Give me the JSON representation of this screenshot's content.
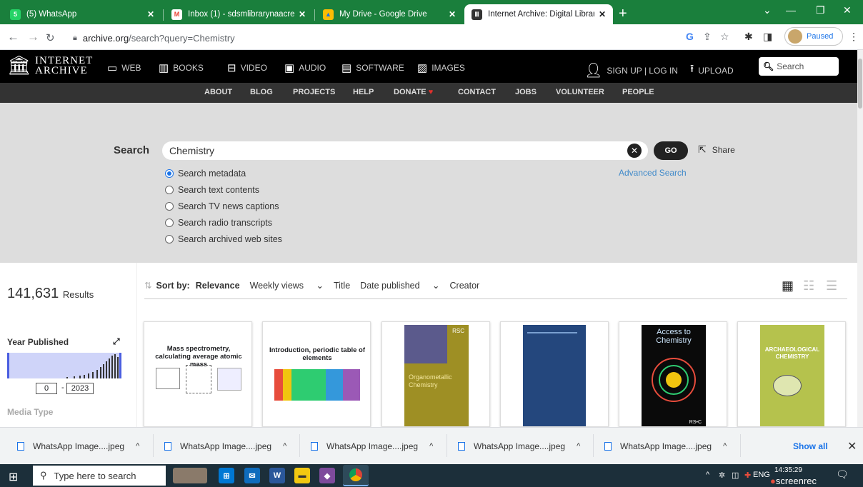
{
  "browser": {
    "tabs": [
      {
        "title": "(5) WhatsApp",
        "favicon": "whatsapp-icon",
        "color": "#25d366"
      },
      {
        "title": "Inbox (1) - sdsmlibrarynaacrepor",
        "favicon": "gmail-icon",
        "color": "#ea4335"
      },
      {
        "title": "My Drive - Google Drive",
        "favicon": "drive-icon",
        "color": "#fbbc04"
      },
      {
        "title": "Internet Archive: Digital Library o",
        "favicon": "archive-icon",
        "color": "#333333"
      }
    ],
    "url_domain": "archive.org",
    "url_path": "/search?query=Chemistry",
    "profile_status": "Paused"
  },
  "ia": {
    "logo_line1": "INTERNET",
    "logo_line2": "ARCHIVE",
    "nav": [
      "WEB",
      "BOOKS",
      "VIDEO",
      "AUDIO",
      "SOFTWARE",
      "IMAGES"
    ],
    "signup": "SIGN UP | LOG IN",
    "upload": "UPLOAD",
    "search_placeholder": "Search",
    "subnav": [
      "ABOUT",
      "BLOG",
      "PROJECTS",
      "HELP",
      "DONATE",
      "CONTACT",
      "JOBS",
      "VOLUNTEER",
      "PEOPLE"
    ]
  },
  "search": {
    "label": "Search",
    "query": "Chemistry",
    "go": "GO",
    "share": "Share",
    "advanced": "Advanced Search",
    "options": [
      "Search metadata",
      "Search text contents",
      "Search TV news captions",
      "Search radio transcripts",
      "Search archived web sites"
    ],
    "selected_index": 0
  },
  "results": {
    "count": "141,631",
    "count_label": "Results",
    "year_title": "Year Published",
    "year_from": "0",
    "year_to": "2023",
    "media_type": "Media Type"
  },
  "sort": {
    "label": "Sort by:",
    "options": [
      "Relevance",
      "Weekly views",
      "Title",
      "Date published",
      "Creator"
    ]
  },
  "tiles": [
    {
      "title": "Mass spectrometry, calculating average atomic mass"
    },
    {
      "title": "Introduction, periodic table of elements"
    },
    {
      "cover_text": "Organometallic Chemistry",
      "publisher": "RSC"
    },
    {
      "cover_text": ""
    },
    {
      "cover_text": "Access to Chemistry",
      "publisher": "RS•C"
    },
    {
      "cover_text": "ARCHAEOLOGICAL CHEMISTRY"
    }
  ],
  "downloads": {
    "items": [
      "WhatsApp Image....jpeg",
      "WhatsApp Image....jpeg",
      "WhatsApp Image....jpeg",
      "WhatsApp Image....jpeg",
      "WhatsApp Image....jpeg"
    ],
    "show_all": "Show all"
  },
  "taskbar": {
    "search_placeholder": "Type here to search",
    "lang": "ENG",
    "time": "14:35:29",
    "recorder": "screenrec"
  }
}
